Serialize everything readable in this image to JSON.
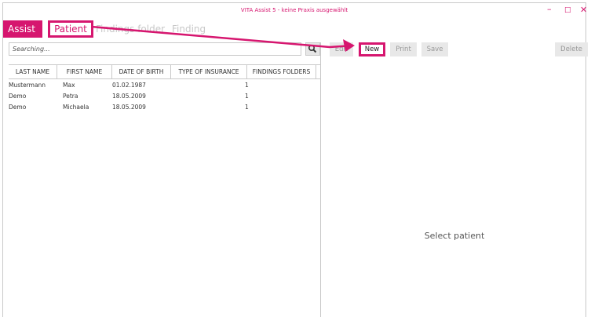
{
  "window": {
    "title": "VITA Assist 5 - keine Praxis ausgewählt",
    "controls": [
      "–",
      "□",
      "✕"
    ]
  },
  "tabs": {
    "assist": "Assist",
    "patient": "Patient",
    "findings_folder": "Findings folder",
    "finding": "Finding"
  },
  "search": {
    "placeholder": "Searching..."
  },
  "table": {
    "headers": [
      "LAST NAME",
      "FIRST NAME",
      "DATE OF BIRTH",
      "TYPE OF INSURANCE",
      "FINDINGS FOLDERS"
    ],
    "rows": [
      [
        "Mustermann",
        "Max",
        "01.02.1987",
        "",
        "1"
      ],
      [
        "Demo",
        "Petra",
        "18.05.2009",
        "",
        "1"
      ],
      [
        "Demo",
        "Michaela",
        "18.05.2009",
        "",
        "1"
      ]
    ]
  },
  "toolbar": {
    "edit": "Edit",
    "new": "New",
    "print": "Print",
    "save": "Save",
    "delete": "Delete"
  },
  "detail": {
    "placeholder": "Select patient"
  },
  "colors": {
    "accent": "#d6166f",
    "border": "#c9c9c9",
    "button_bg": "#e8e8e8"
  }
}
